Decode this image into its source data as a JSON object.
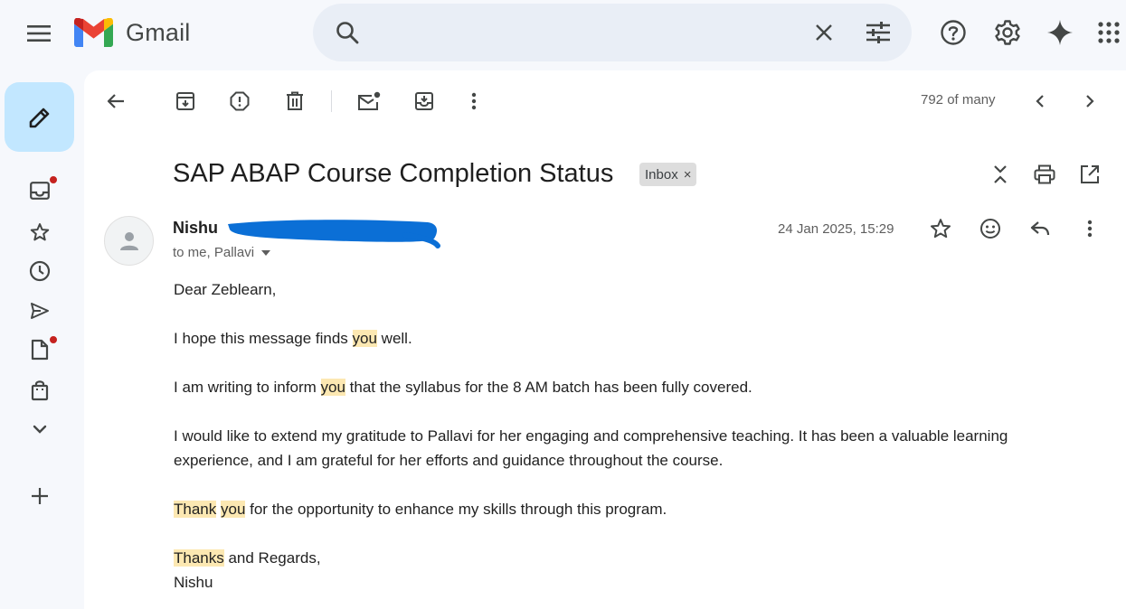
{
  "header": {
    "app_name": "Gmail",
    "search_placeholder": ""
  },
  "toolbar": {
    "counter": "792 of many"
  },
  "email": {
    "subject": "SAP ABAP Course Completion Status",
    "label": "Inbox",
    "label_remove": "×",
    "sender_name": "Nishu",
    "recipients": "to me, Pallavi",
    "date": "24 Jan 2025, 15:29",
    "body": {
      "greeting": "Dear Zeblearn,",
      "p1": [
        "I hope this message finds ",
        "you",
        " well."
      ],
      "p2": [
        "I am writing to inform ",
        "you",
        " that the syllabus for the 8 AM batch has been fully covered."
      ],
      "p3": "I would like to extend my gratitude to Pallavi for her engaging and comprehensive teaching. It has been a valuable learning experience, and I am grateful for her efforts and guidance throughout the course.",
      "p4": [
        "Thank",
        " ",
        "you",
        " for the opportunity to enhance my skills through this program."
      ],
      "closing": [
        "Thanks",
        " and Regards,"
      ],
      "signature": "Nishu"
    }
  },
  "colors": {
    "compose_bg": "#c2e7ff",
    "search_bg": "#e9eef6",
    "highlight": "#fce8b2",
    "unread_dot": "#c5221f",
    "redaction": "#0b6fd6"
  },
  "icons": {
    "menu": "menu-icon",
    "search": "search-icon",
    "clear": "close-icon",
    "filter": "tune-icon",
    "help": "help-icon",
    "settings": "gear-icon",
    "gemini": "sparkle-icon",
    "apps": "apps-grid-icon"
  }
}
